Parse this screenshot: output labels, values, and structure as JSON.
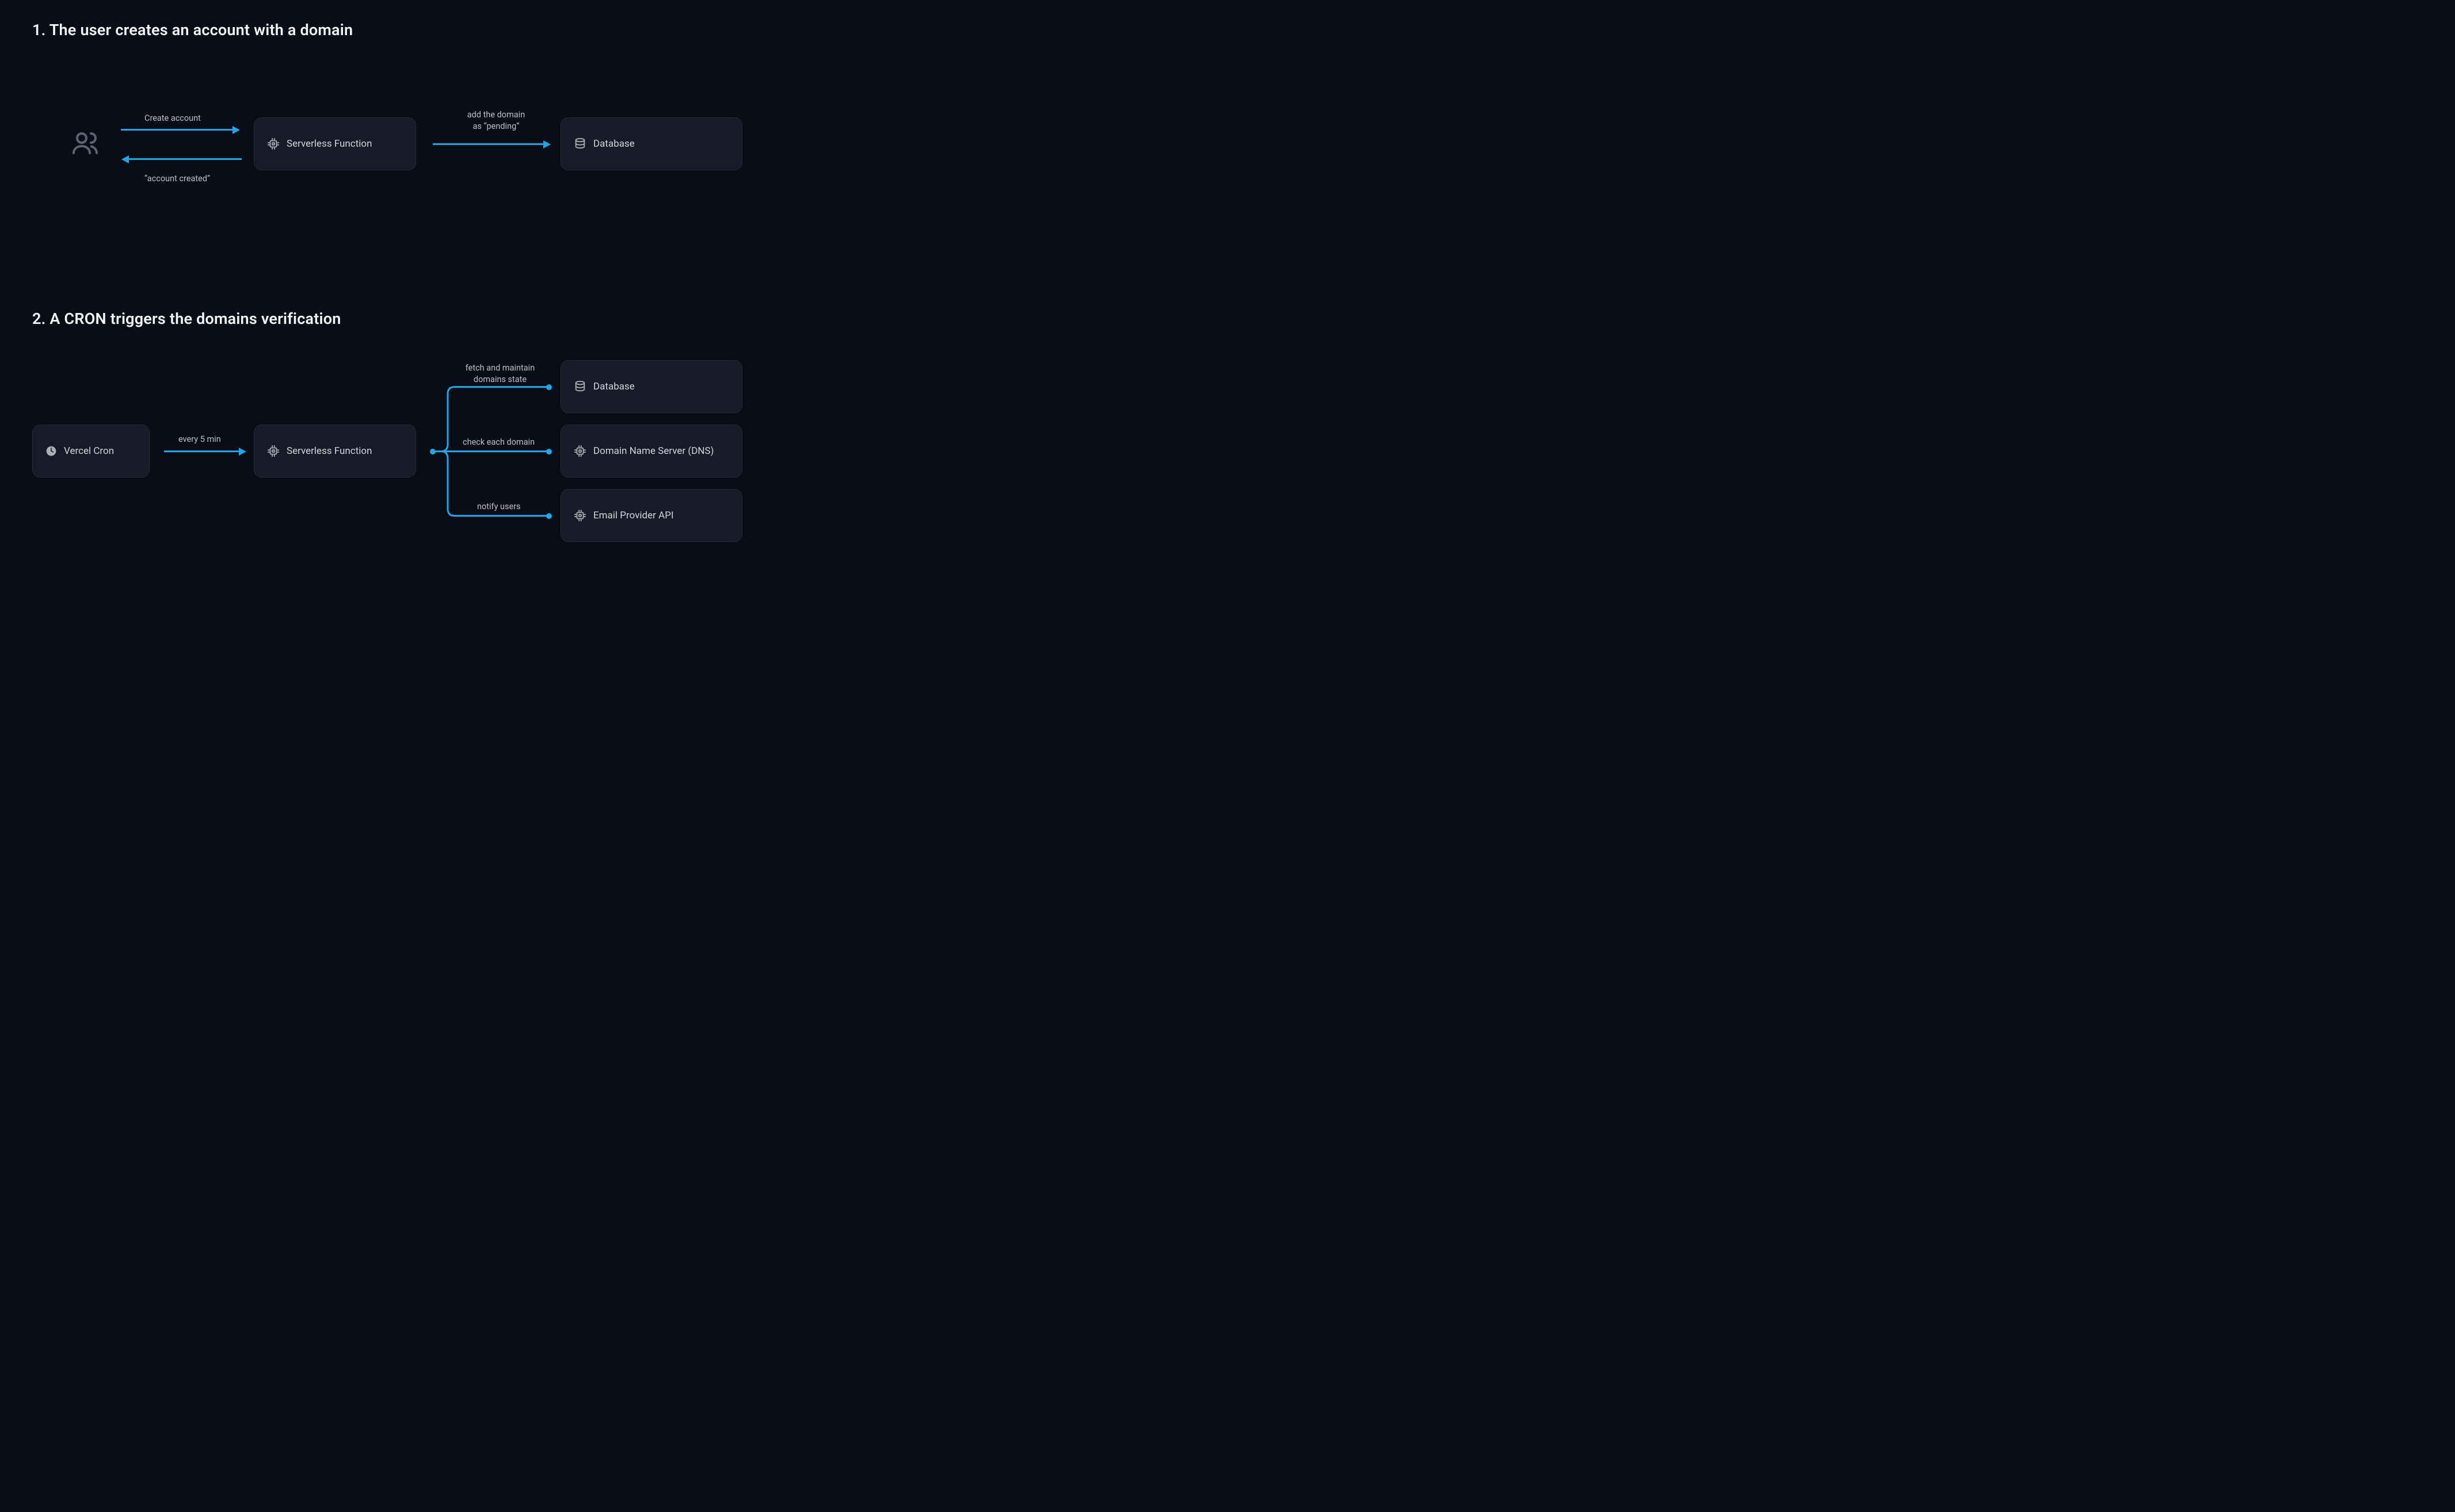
{
  "section1": {
    "title": "1. The user creates an account with a domain",
    "arrow_create_label": "Create account",
    "arrow_created_label": "“account created”",
    "node_serverless": "Serverless Function",
    "arrow_add_domain_line1": "add the domain",
    "arrow_add_domain_line2": "as “pending”",
    "node_database": "Database"
  },
  "section2": {
    "title": "2. A CRON triggers the domains verification",
    "node_cron": "Vercel Cron",
    "arrow_every5_label": "every 5 min",
    "node_serverless": "Serverless Function",
    "branch1_line1": "fetch and maintain",
    "branch1_line2": "domains state",
    "node_database": "Database",
    "branch2_label": "check each domain",
    "node_dns": "Domain Name Server (DNS)",
    "branch3_label": "notify users",
    "node_email": "Email Provider API"
  },
  "colors": {
    "accent": "#1ea7e6",
    "panel_bg": "#171b27",
    "panel_border": "#262b38",
    "bg": "#0a0d17"
  }
}
